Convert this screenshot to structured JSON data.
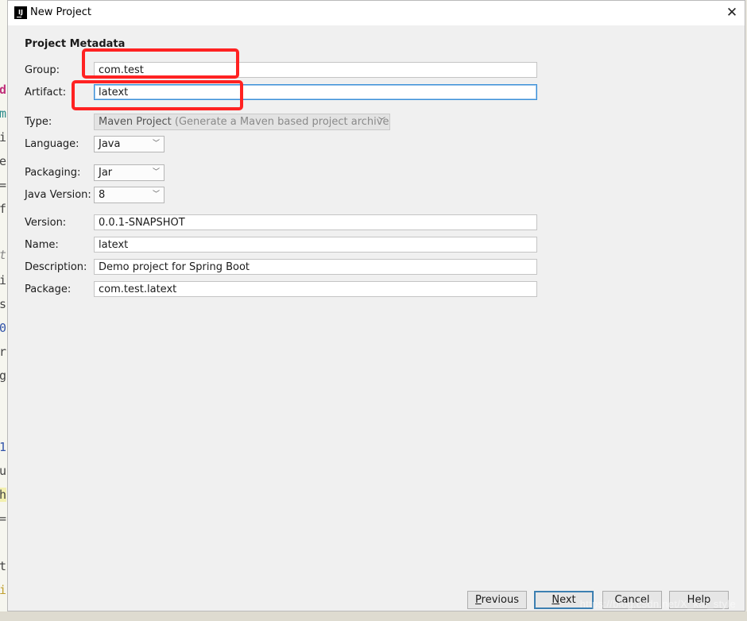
{
  "window": {
    "title": "New Project",
    "icon": "intellij-icon",
    "icon_text": "IJ"
  },
  "section_title": "Project Metadata",
  "fields": {
    "group": {
      "label": "Group:",
      "value": "com.test"
    },
    "artifact": {
      "label": "Artifact:",
      "value": "latext"
    },
    "version": {
      "label": "Version:",
      "value": "0.0.1-SNAPSHOT"
    },
    "name": {
      "label": "Name:",
      "value": "latext"
    },
    "description": {
      "label": "Description:",
      "value": "Demo project for Spring Boot"
    },
    "package": {
      "label": "Package:",
      "value": "com.test.latext"
    }
  },
  "selects": {
    "type": {
      "label": "Type:",
      "value": "Maven Project",
      "hint": "(Generate a Maven based project archive)"
    },
    "language": {
      "label": "Language:",
      "value": "Java"
    },
    "packaging": {
      "label": "Packaging:",
      "value": "Jar"
    },
    "java_version": {
      "label": "Java Version:",
      "value": "8"
    }
  },
  "buttons": {
    "previous": {
      "mnemonic": "P",
      "rest": "revious"
    },
    "next": {
      "mnemonic": "N",
      "rest": "ext"
    },
    "cancel": {
      "label": "Cancel"
    },
    "help": {
      "label": "Help"
    }
  },
  "background_editor_chars": [
    "d",
    "m",
    "i",
    "e",
    "=",
    "f",
    "t",
    "i",
    "s",
    "0",
    "r",
    "g",
    "1",
    "u",
    "h",
    "=",
    "t",
    "i"
  ],
  "watermark": "https://blog.csdn.net/X_kai_style",
  "colors": {
    "annotation": "#ff2222",
    "focus": "#3a8fd8",
    "dialog_bg": "#f0f0f0"
  }
}
